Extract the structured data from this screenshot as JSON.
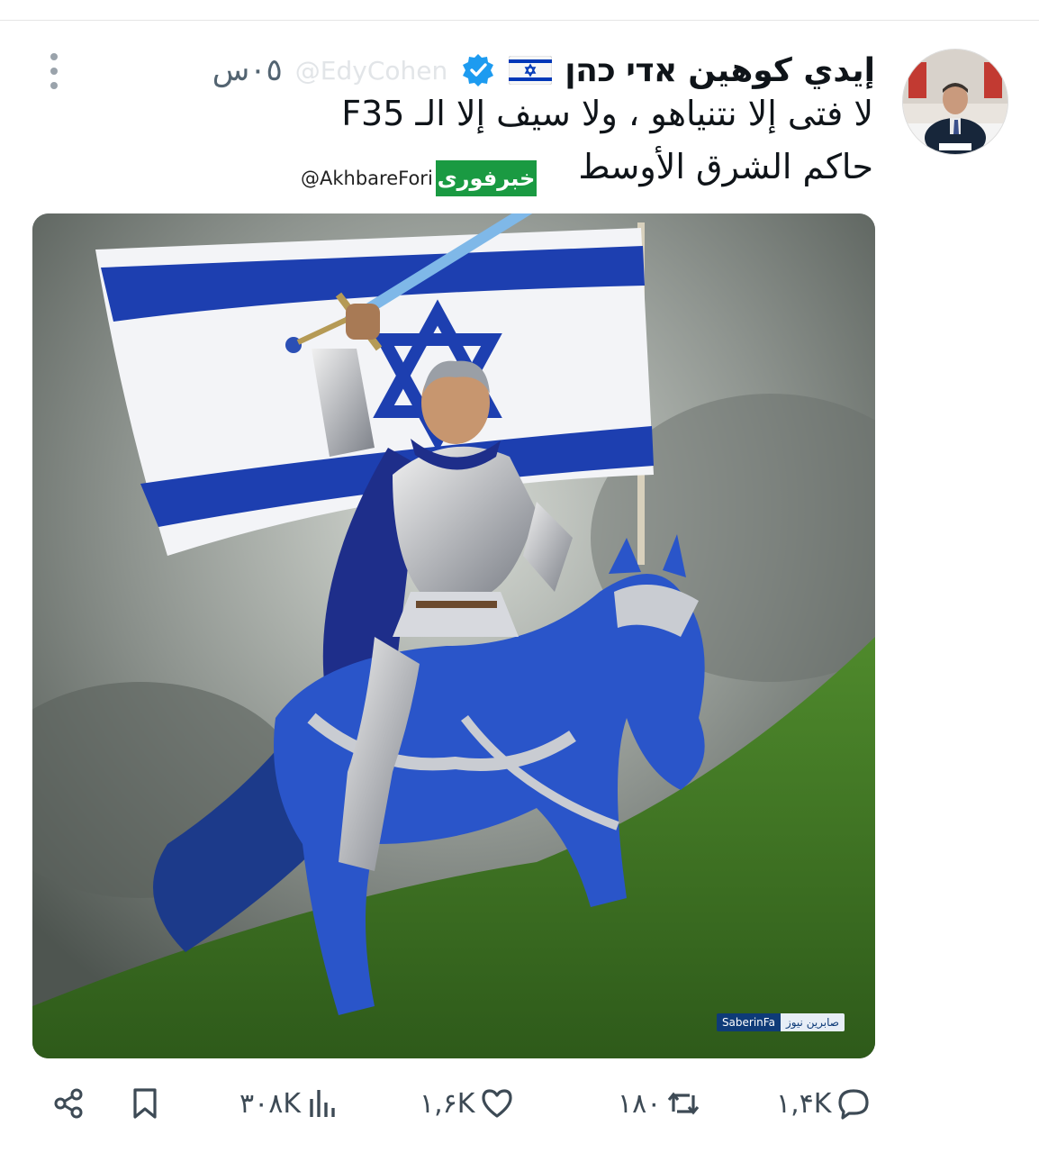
{
  "tweet": {
    "display_name": "إيدي كوهين אדי כהן",
    "handle": "@EdyCohen",
    "time_ago": "٠٥س",
    "text_line1": "لا فتى إلا نتنياهو ، ولا سيف إلا الـ F35",
    "text_line2": "حاكم الشرق الأوسط"
  },
  "watermark": {
    "logo_text": "خبرفوری",
    "handle": "@AkhbareFori"
  },
  "media": {
    "watermark_handle": "SaberinFa",
    "watermark_label": "صابرين نيوز"
  },
  "actions": {
    "replies": "١,۴K",
    "reposts": "١٨٠",
    "likes": "١,۶K",
    "views": "٣٠٨K"
  },
  "icons": {
    "more": "more-vertical-icon",
    "verified": "verified-badge-icon",
    "flag": "israel-flag-icon",
    "reply": "reply-icon",
    "repost": "repost-icon",
    "like": "heart-icon",
    "views": "views-chart-icon",
    "bookmark": "bookmark-icon",
    "share": "share-icon"
  },
  "colors": {
    "verified_blue": "#1d9bf0",
    "flag_blue": "#0038b8",
    "muted_text": "#536471",
    "watermark_green": "#1a9a42"
  }
}
